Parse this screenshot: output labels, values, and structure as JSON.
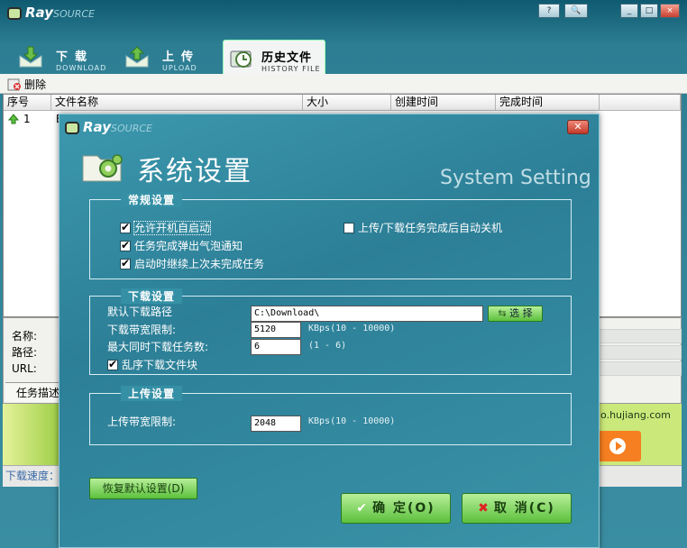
{
  "app": {
    "brand": "Ray",
    "brand_sub": "SOURCE"
  },
  "window_buttons": [
    "?",
    "🔍",
    "_",
    "□",
    "×"
  ],
  "tabs": [
    {
      "zh": "下载",
      "en": "DOWNLOAD"
    },
    {
      "zh": "上传",
      "en": "UPLOAD"
    },
    {
      "zh": "历史文件",
      "en": "HISTORY FILE"
    }
  ],
  "toolbar": {
    "delete_label": "删除"
  },
  "grid": {
    "columns": [
      "序号",
      "文件名称",
      "大小",
      "创建时间",
      "完成时间"
    ],
    "rows": [
      {
        "index": "1",
        "name": "E"
      }
    ]
  },
  "info": {
    "name_label": "名称:",
    "path_label": "路径:",
    "url_label": "URL:",
    "desc_tab": "任务描述"
  },
  "ad": {
    "url": "lo.hujiang.com"
  },
  "status": {
    "download_speed_label": "下载速度："
  },
  "dialog": {
    "brand": "Ray",
    "brand_sub": "SOURCE",
    "title_zh": "系统设置",
    "title_en": "System Setting",
    "general": {
      "title": "常规设置",
      "options": [
        {
          "label": "允许开机自启动",
          "checked": true
        },
        {
          "label": "任务完成弹出气泡通知",
          "checked": true
        },
        {
          "label": "启动时继续上次未完成任务",
          "checked": true
        },
        {
          "label": "上传/下载任务完成后自动关机",
          "checked": false
        }
      ]
    },
    "download": {
      "title": "下载设置",
      "path_label": "默认下载路径",
      "path_value": "C:\\Download\\",
      "browse_label": "选 择",
      "speed_label": "下载带宽限制:",
      "speed_value": "5120",
      "speed_unit": "KBps(10 - 10000)",
      "max_label": "最大同时下载任务数:",
      "max_value": "6",
      "max_range": "(1 - 6)",
      "random_label": "乱序下载文件块",
      "random_checked": true
    },
    "upload": {
      "title": "上传设置",
      "speed_label": "上传带宽限制:",
      "speed_value": "2048",
      "speed_unit": "KBps(10 - 10000)"
    },
    "restore_label": "恢复默认设置(D)",
    "ok_label": "确 定(O)",
    "cancel_label": "取 消(C)"
  }
}
